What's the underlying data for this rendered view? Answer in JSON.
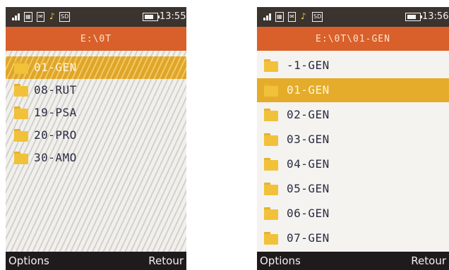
{
  "left_screen": {
    "status": {
      "time": "13:55",
      "sd_label": "SD"
    },
    "title": "E:\\0T",
    "items": [
      {
        "label": "01-GEN",
        "selected": true
      },
      {
        "label": "08-RUT",
        "selected": false
      },
      {
        "label": "19-PSA",
        "selected": false
      },
      {
        "label": "20-PRO",
        "selected": false
      },
      {
        "label": "30-AMO",
        "selected": false
      }
    ],
    "softkeys": {
      "left": "Options",
      "right": "Retour"
    }
  },
  "right_screen": {
    "status": {
      "time": "13:56",
      "sd_label": "SD"
    },
    "title": "E:\\0T\\01-GEN",
    "items": [
      {
        "label": "-1-GEN",
        "selected": false
      },
      {
        "label": "01-GEN",
        "selected": true
      },
      {
        "label": "02-GEN",
        "selected": false
      },
      {
        "label": "03-GEN",
        "selected": false
      },
      {
        "label": "04-GEN",
        "selected": false
      },
      {
        "label": "05-GEN",
        "selected": false
      },
      {
        "label": "06-GEN",
        "selected": false
      },
      {
        "label": "07-GEN",
        "selected": false
      }
    ],
    "softkeys": {
      "left": "Options",
      "right": "Retour"
    }
  },
  "icons": [
    "signal-icon",
    "network-icon",
    "message-icon",
    "music-note-icon",
    "sd-card-icon",
    "battery-icon",
    "folder-icon"
  ],
  "colors": {
    "title_bar": "#d9602a",
    "status_bar": "#3b332e",
    "selection": "#e4ac2a",
    "folder": "#f2c13a",
    "softkey_bar": "#1f1b1d"
  }
}
